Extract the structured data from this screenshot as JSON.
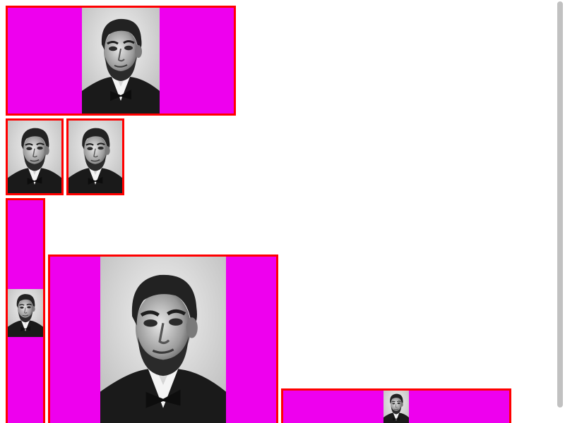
{
  "images": [
    {
      "subject": "portrait",
      "colors": {
        "frame_border": "#ff0000",
        "frame_fill": "#ee00ee"
      }
    },
    {
      "subject": "portrait"
    },
    {
      "subject": "portrait"
    },
    {
      "subject": "portrait"
    },
    {
      "subject": "portrait"
    },
    {
      "subject": "portrait"
    }
  ],
  "scrollbar": {
    "orientation": "vertical"
  }
}
